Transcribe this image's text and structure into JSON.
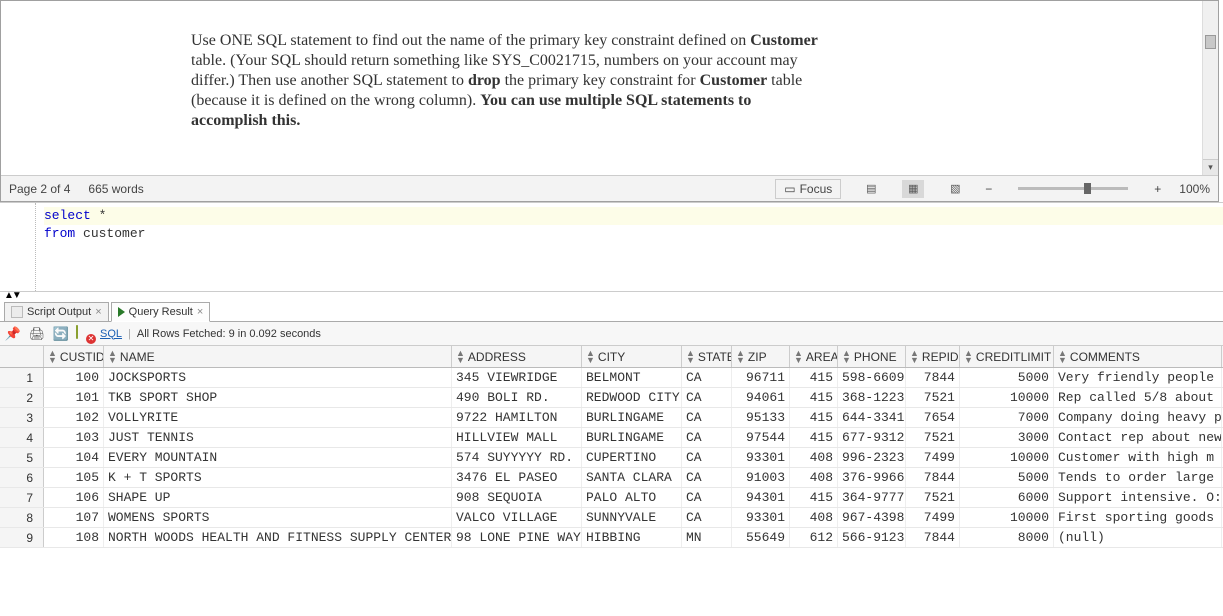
{
  "document_pane": {
    "text_plain": "Use ONE SQL statement to find out the name of the primary key constraint defined on ",
    "bold1": "Customer",
    "mid1": " table. (Your SQL should return something like SYS_C0021715, numbers on your account may differ.) Then use another SQL statement to ",
    "bold2": "drop",
    "mid2": " the primary key constraint for ",
    "bold3": "Customer",
    "mid3": " table (because it is defined on the wrong column). ",
    "bold4": "You can use multiple SQL statements to accomplish this."
  },
  "status_bar": {
    "page": "Page 2 of 4",
    "words": "665 words",
    "focus": "Focus",
    "zoom": "100%",
    "minus": "−",
    "plus": "+"
  },
  "sql": {
    "line1_kw": "select",
    "line1_rest": " *",
    "line2_kw": "from",
    "line2_rest": " customer"
  },
  "tabs": {
    "script_output": "Script Output",
    "query_result": "Query Result"
  },
  "toolbar": {
    "sql_link": "SQL",
    "separator": "|",
    "fetched": "All Rows Fetched: 9 in 0.092 seconds"
  },
  "columns": [
    "CUSTID",
    "NAME",
    "ADDRESS",
    "CITY",
    "STATE",
    "ZIP",
    "AREA",
    "PHONE",
    "REPID",
    "CREDITLIMIT",
    "COMMENTS"
  ],
  "rows": [
    {
      "n": "1",
      "custid": "100",
      "name": "JOCKSPORTS",
      "address": "345 VIEWRIDGE",
      "city": "BELMONT",
      "state": "CA",
      "zip": "96711",
      "area": "415",
      "phone": "598-6609",
      "repid": "7844",
      "creditlimit": "5000",
      "comments": "Very friendly people"
    },
    {
      "n": "2",
      "custid": "101",
      "name": "TKB SPORT SHOP",
      "address": "490 BOLI RD.",
      "city": "REDWOOD CITY",
      "state": "CA",
      "zip": "94061",
      "area": "415",
      "phone": "368-1223",
      "repid": "7521",
      "creditlimit": "10000",
      "comments": "Rep called 5/8 about"
    },
    {
      "n": "3",
      "custid": "102",
      "name": "VOLLYRITE",
      "address": "9722 HAMILTON",
      "city": "BURLINGAME",
      "state": "CA",
      "zip": "95133",
      "area": "415",
      "phone": "644-3341",
      "repid": "7654",
      "creditlimit": "7000",
      "comments": "Company doing heavy p"
    },
    {
      "n": "4",
      "custid": "103",
      "name": "JUST TENNIS",
      "address": "HILLVIEW MALL",
      "city": "BURLINGAME",
      "state": "CA",
      "zip": "97544",
      "area": "415",
      "phone": "677-9312",
      "repid": "7521",
      "creditlimit": "3000",
      "comments": "Contact rep about new"
    },
    {
      "n": "5",
      "custid": "104",
      "name": "EVERY MOUNTAIN",
      "address": "574 SUYYYYY RD.",
      "city": "CUPERTINO",
      "state": "CA",
      "zip": "93301",
      "area": "408",
      "phone": "996-2323",
      "repid": "7499",
      "creditlimit": "10000",
      "comments": "Customer with high m"
    },
    {
      "n": "6",
      "custid": "105",
      "name": "K + T SPORTS",
      "address": "3476 EL PASEO",
      "city": "SANTA CLARA",
      "state": "CA",
      "zip": "91003",
      "area": "408",
      "phone": "376-9966",
      "repid": "7844",
      "creditlimit": "5000",
      "comments": "Tends to order large"
    },
    {
      "n": "7",
      "custid": "106",
      "name": "SHAPE UP",
      "address": "908 SEQUOIA",
      "city": "PALO ALTO",
      "state": "CA",
      "zip": "94301",
      "area": "415",
      "phone": "364-9777",
      "repid": "7521",
      "creditlimit": "6000",
      "comments": "Support intensive. O:"
    },
    {
      "n": "8",
      "custid": "107",
      "name": "WOMENS SPORTS",
      "address": "VALCO VILLAGE",
      "city": "SUNNYVALE",
      "state": "CA",
      "zip": "93301",
      "area": "408",
      "phone": "967-4398",
      "repid": "7499",
      "creditlimit": "10000",
      "comments": "First sporting goods"
    },
    {
      "n": "9",
      "custid": "108",
      "name": "NORTH WOODS HEALTH AND FITNESS SUPPLY CENTER",
      "address": "98 LONE PINE WAY",
      "city": "HIBBING",
      "state": "MN",
      "zip": "55649",
      "area": "612",
      "phone": "566-9123",
      "repid": "7844",
      "creditlimit": "8000",
      "comments": "(null)"
    }
  ]
}
